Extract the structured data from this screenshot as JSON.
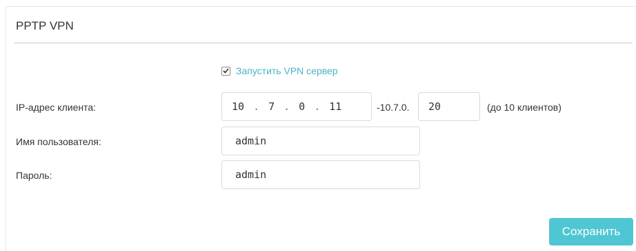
{
  "section": {
    "title": "PPTP VPN"
  },
  "enable": {
    "label": "Запустить VPN сервер",
    "checked": true
  },
  "client_ip": {
    "label": "IP-адрес клиента:",
    "octets": [
      "10",
      "7",
      "0",
      "11"
    ],
    "range_prefix": "-10.7.0.",
    "range_end": "20",
    "hint": "(до 10 клиентов)"
  },
  "username": {
    "label": "Имя пользователя:",
    "value": "admin"
  },
  "password": {
    "label": "Пароль:",
    "value": "admin"
  },
  "actions": {
    "save_label": "Сохранить"
  },
  "colors": {
    "accent": "#4fc6d3",
    "link": "#4ab3c6"
  }
}
